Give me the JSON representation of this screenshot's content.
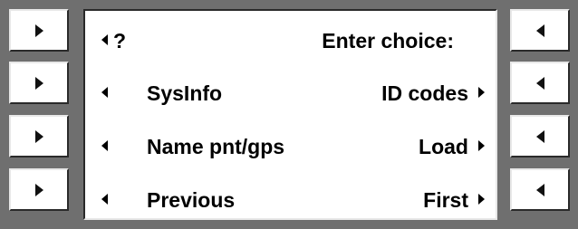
{
  "prompt": {
    "qmark": "?",
    "title": "Enter choice:"
  },
  "menu": [
    {
      "left_label": "SysInfo",
      "right_label": "ID codes"
    },
    {
      "left_label": "Name pnt/gps",
      "right_label": "Load"
    },
    {
      "left_label": "Previous",
      "right_label": "First"
    }
  ],
  "icons": {
    "left_softkey": "triangle-right-icon",
    "right_softkey": "triangle-left-icon",
    "left_indicator": "triangle-left-icon",
    "right_indicator": "triangle-right-icon"
  },
  "colors": {
    "bezel": "#6f6f6f",
    "screen": "#ffffff",
    "text": "#000000"
  }
}
